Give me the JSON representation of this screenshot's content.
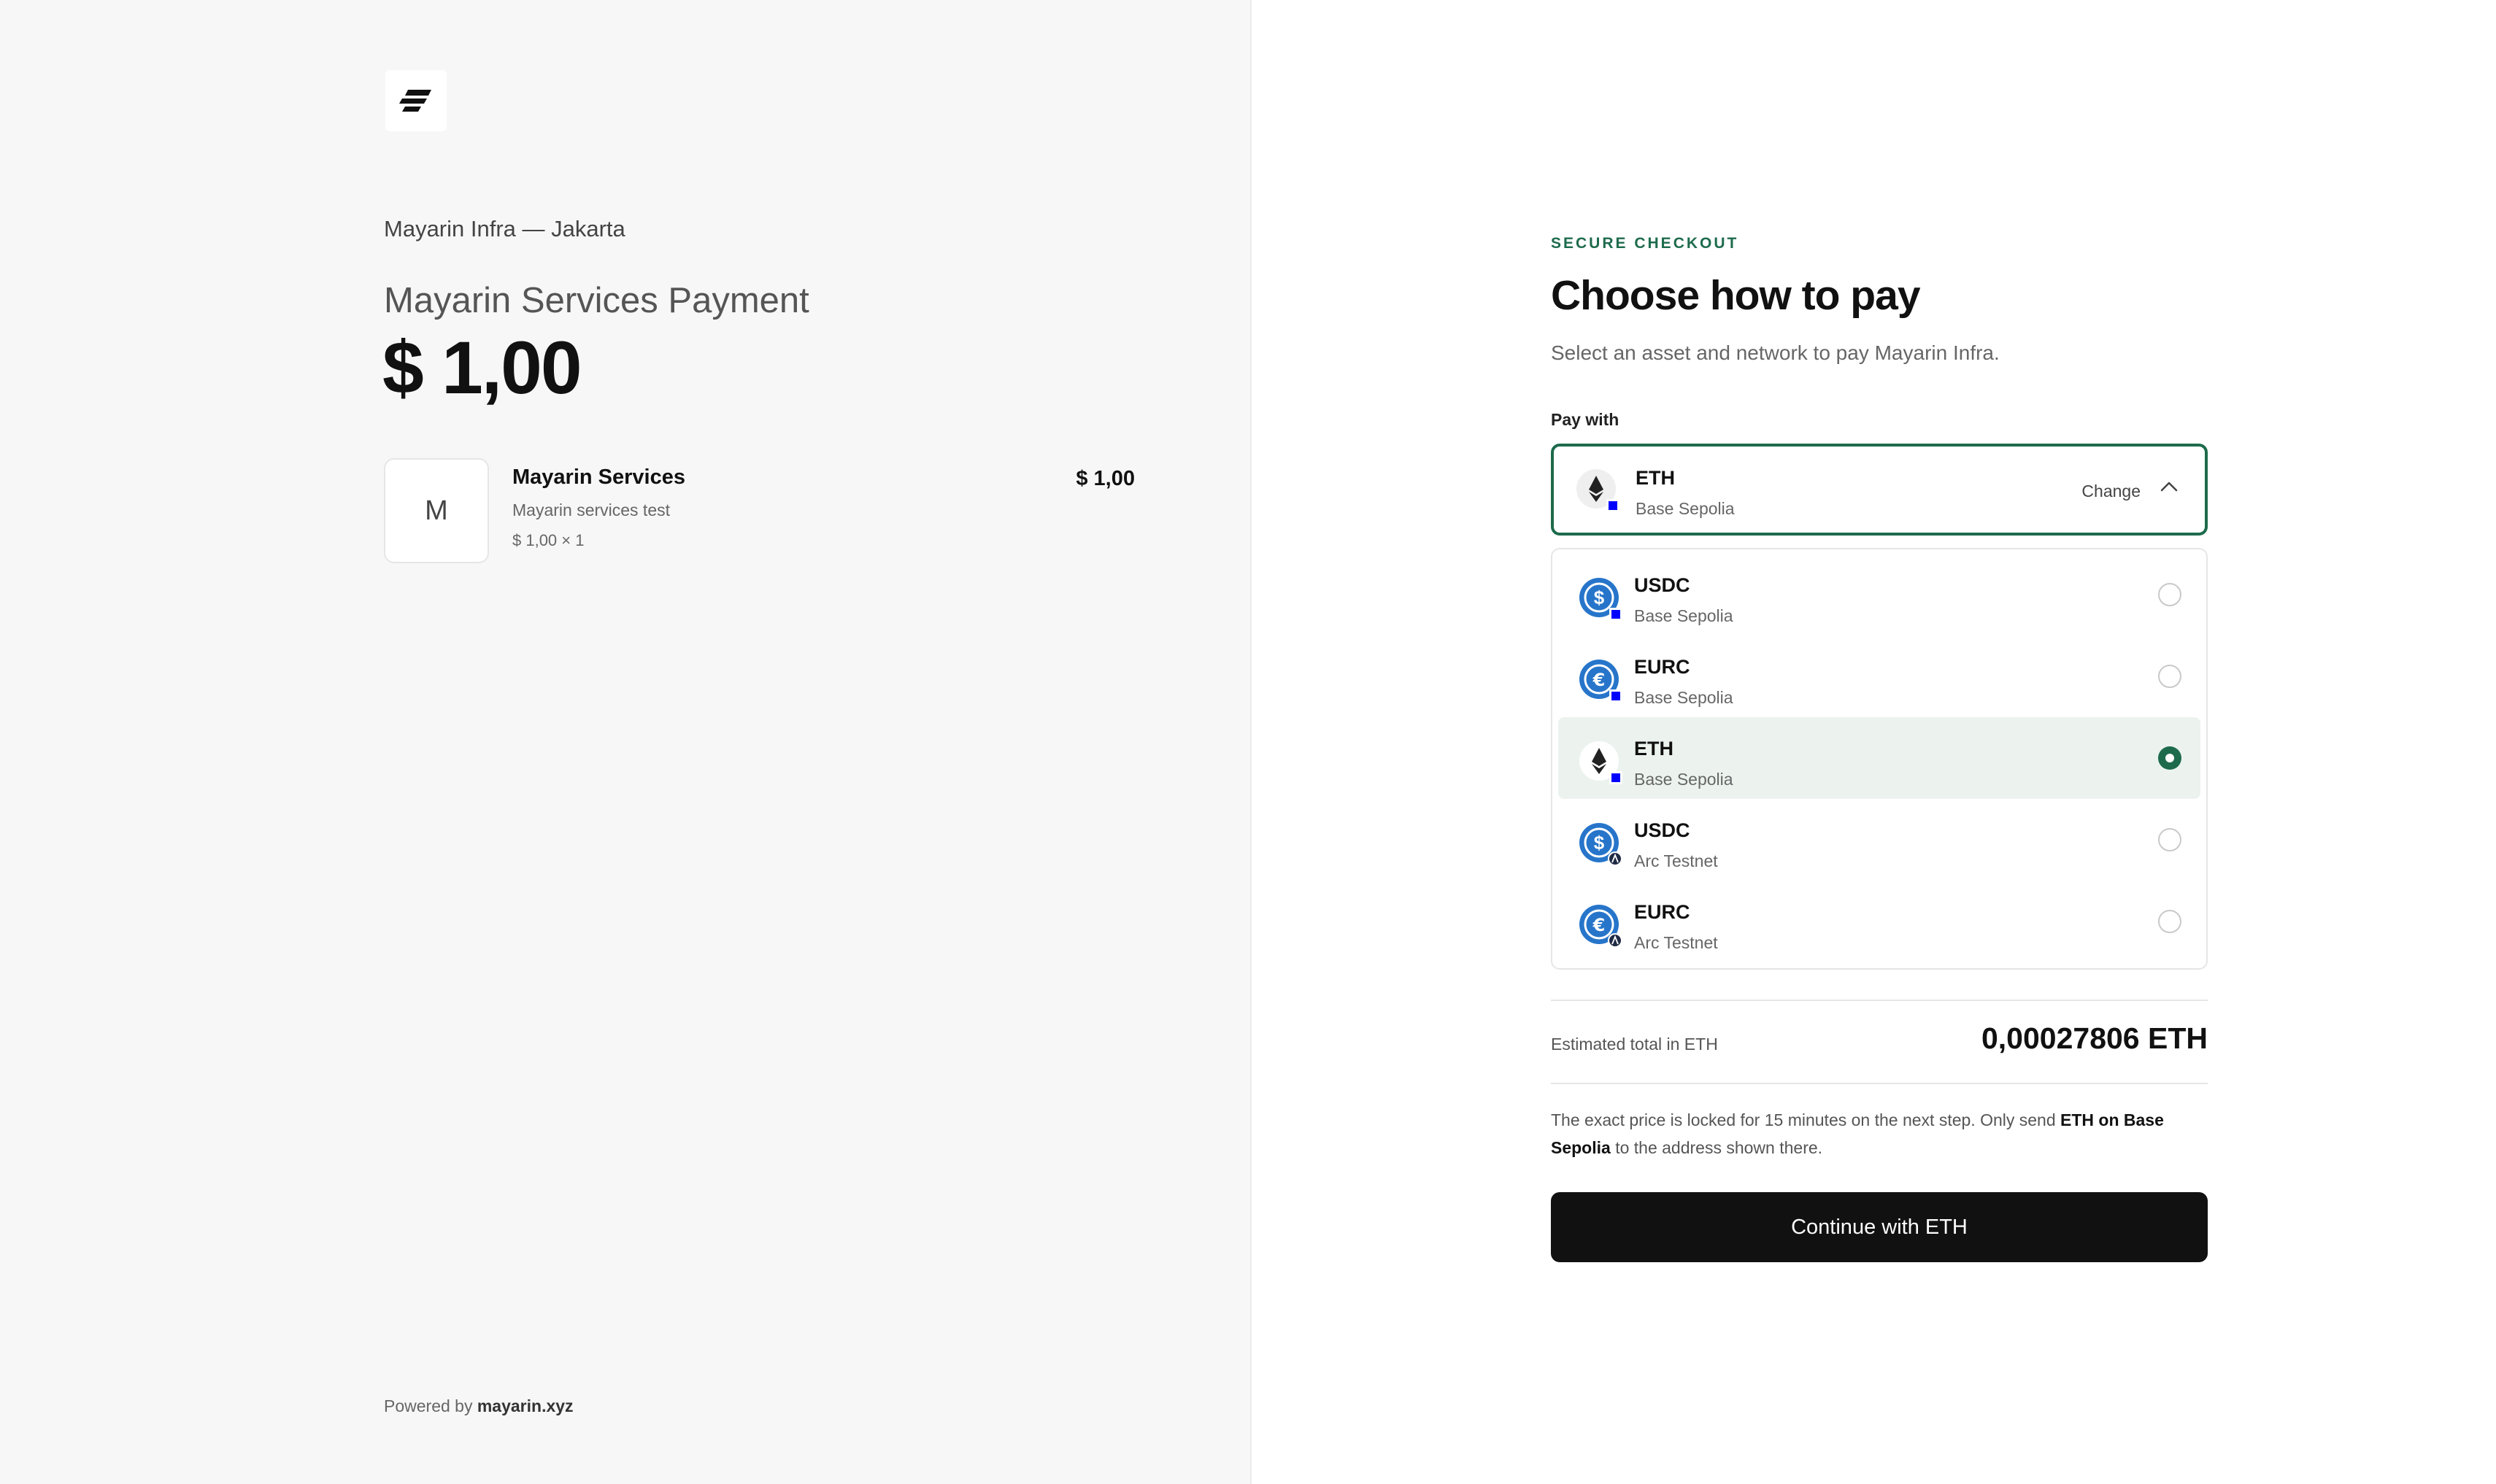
{
  "merchant": {
    "location": "Mayarin Infra — Jakarta",
    "payment_title": "Mayarin Services Payment",
    "amount": "$ 1,00"
  },
  "line_item": {
    "thumb_letter": "M",
    "name": "Mayarin Services",
    "description": "Mayarin services test",
    "quantity": "$ 1,00 × 1",
    "price": "$ 1,00"
  },
  "footer": {
    "powered_prefix": "Powered by",
    "powered_brand": "mayarin.xyz"
  },
  "checkout": {
    "eyebrow": "SECURE CHECKOUT",
    "heading": "Choose how to pay",
    "subheading": "Select an asset and network to pay Mayarin Infra.",
    "pay_with_label": "Pay with",
    "selected": {
      "asset": "ETH",
      "network": "Base Sepolia",
      "change_label": "Change"
    },
    "options": [
      {
        "asset": "USDC",
        "network": "Base Sepolia",
        "icon": "usdc-icon",
        "selected": false
      },
      {
        "asset": "EURC",
        "network": "Base Sepolia",
        "icon": "eurc-icon",
        "selected": false
      },
      {
        "asset": "ETH",
        "network": "Base Sepolia",
        "icon": "eth-icon",
        "selected": true
      },
      {
        "asset": "USDC",
        "network": "Arc Testnet",
        "icon": "usdc-icon",
        "selected": false
      },
      {
        "asset": "EURC",
        "network": "Arc Testnet",
        "icon": "eurc-icon",
        "selected": false
      }
    ],
    "estimate_label": "Estimated total in ETH",
    "estimate_value": "0,00027806 ETH",
    "note": {
      "part1": "The exact price is locked for 15 minutes on the next step. Only send ",
      "bold": "ETH on Base Sepolia",
      "part2": " to the address shown there."
    },
    "cta_label": "Continue with ETH"
  },
  "colors": {
    "accent": "#1d6b4c",
    "accent_soft": "#ecf3ef",
    "usdc_blue": "#2775ca",
    "base_blue": "#0000ff",
    "arc_navy": "#1f2a44",
    "button_bg": "#111111"
  }
}
